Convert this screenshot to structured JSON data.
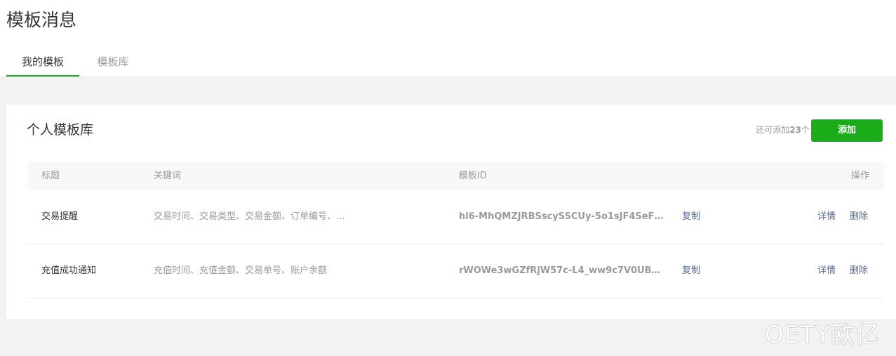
{
  "page": {
    "title": "模板消息"
  },
  "tabs": [
    {
      "label": "我的模板",
      "active": true
    },
    {
      "label": "模板库",
      "active": false
    }
  ],
  "card": {
    "title": "个人模板库",
    "quota_prefix": "还可添加",
    "quota_count": "23",
    "quota_suffix": "个",
    "add_label": "添加"
  },
  "table": {
    "headers": {
      "title": "标题",
      "keywords": "关键词",
      "template_id": "模板ID",
      "actions": "操作"
    },
    "rows": [
      {
        "title": "交易提醒",
        "keywords": "交易时间、交易类型、交易金额、订单编号、...",
        "template_id": "hl6-MhQMZJRBSscySSCUy-5o1sJF4SeF3...",
        "copy": "复制",
        "detail": "详情",
        "delete": "删除"
      },
      {
        "title": "充值成功通知",
        "keywords": "充值时间、充值金额、交易单号、账户余额",
        "template_id": "rWOWe3wGZfRjW57c-L4_ww9c7V0UBVg7...",
        "copy": "复制",
        "detail": "详情",
        "delete": "删除"
      }
    ]
  },
  "watermark": "OETY欧亿",
  "colors": {
    "accent": "#1aad19",
    "link": "#576b95",
    "muted": "#9a9a9a",
    "text": "#353535"
  }
}
